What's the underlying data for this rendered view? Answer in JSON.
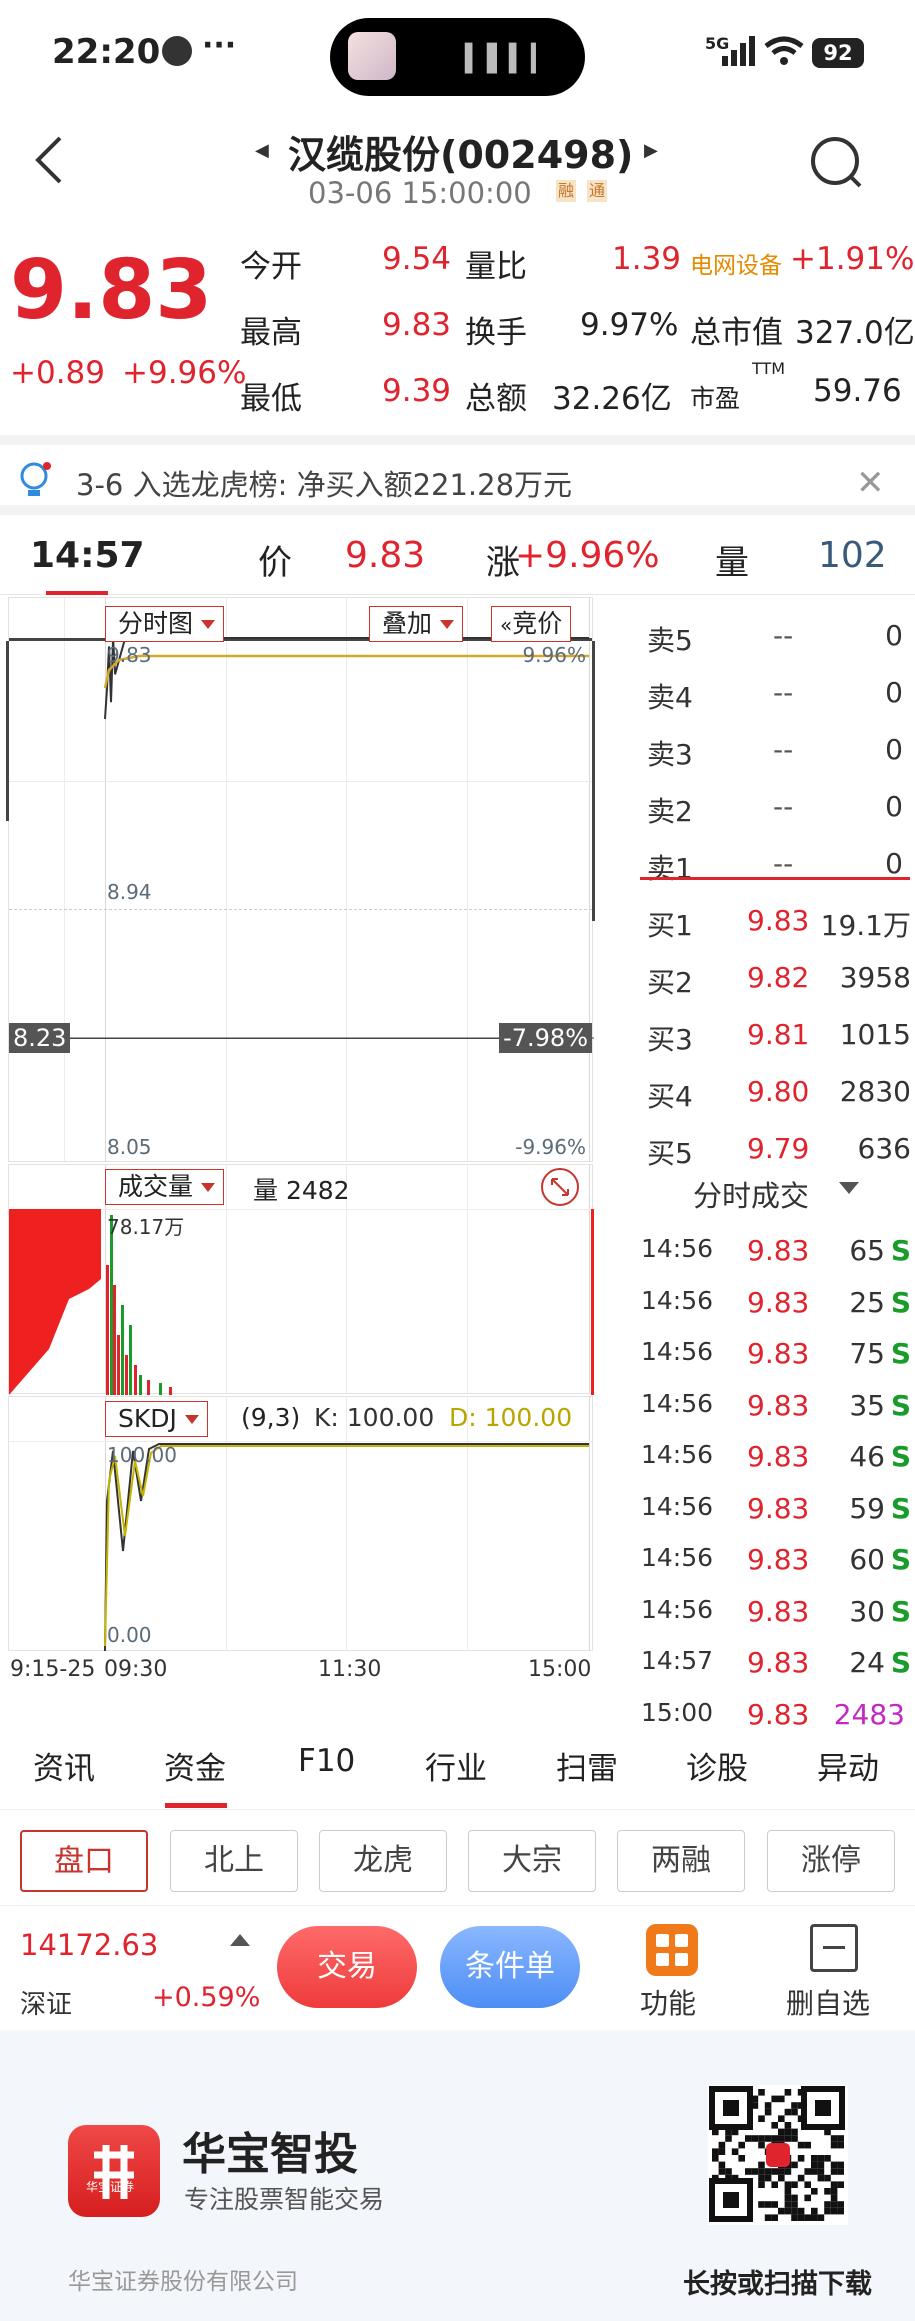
{
  "status_bar": {
    "time": "22:20",
    "more": "···",
    "network": "5G",
    "battery": "92"
  },
  "header": {
    "title": "汉缆股份(002498)",
    "datetime": "03-06 15:00:00",
    "badge_rong": "融",
    "badge_tong": "通"
  },
  "quote": {
    "price": "9.83",
    "change": "+0.89",
    "change_pct": "+9.96%",
    "rows": [
      {
        "l1": "今开",
        "v1": "9.54",
        "l2": "量比",
        "v2": "1.39",
        "l3": "电网设备",
        "v3": "+1.91%"
      },
      {
        "l1": "最高",
        "v1": "9.83",
        "l2": "换手",
        "v2": "9.97%",
        "l3": "总市值",
        "v3": "327.0亿"
      },
      {
        "l1": "最低",
        "v1": "9.39",
        "l2": "总额",
        "v2": "32.26亿",
        "l3": "市盈",
        "l3sup": "TTM",
        "v3": "59.76"
      }
    ]
  },
  "news": {
    "text": "3-6 入选龙虎榜: 净买入额221.28万元"
  },
  "realtime": {
    "time": "14:57",
    "price_label": "价",
    "price": "9.83",
    "chg_label": "涨",
    "chg": "+9.96%",
    "vol_label": "量",
    "vol": "102"
  },
  "chart_top": {
    "dropdown": "分时图",
    "overlay": "叠加",
    "auction": "竞价",
    "hi_price": "9.83",
    "hi_pct": "9.96%",
    "mid_price": "8.94",
    "prev_close": "8.23",
    "prev_pct": "-7.98%",
    "lo_price": "8.05",
    "lo_pct": "-9.96%"
  },
  "chart_vol": {
    "dropdown": "成交量",
    "vol_label": "量 2482",
    "max": "78.17万"
  },
  "chart_skdj": {
    "dropdown": "SKDJ",
    "params": "(9,3)",
    "k": "K: 100.00",
    "d": "D: 100.00",
    "top": "100.00",
    "bottom": "0.00"
  },
  "xaxis": {
    "t0": "9:15-25",
    "t1": "09:30",
    "t2": "11:30",
    "t3": "15:00"
  },
  "chart_data": {
    "type": "line",
    "title": "分时图",
    "x": [
      "09:30",
      "09:31",
      "09:32",
      "09:33",
      "09:34",
      "09:35",
      "09:40",
      "10:00",
      "11:30",
      "13:00",
      "14:57",
      "15:00"
    ],
    "series": [
      {
        "name": "价",
        "values": [
          9.54,
          9.65,
          9.8,
          9.6,
          9.83,
          9.7,
          9.83,
          9.83,
          9.83,
          9.83,
          9.83,
          9.83
        ]
      }
    ],
    "ylim": [
      8.05,
      9.83
    ],
    "prev_close": 8.23
  },
  "book": {
    "sells": [
      {
        "label": "卖5",
        "price": "--",
        "vol": "0"
      },
      {
        "label": "卖4",
        "price": "--",
        "vol": "0"
      },
      {
        "label": "卖3",
        "price": "--",
        "vol": "0"
      },
      {
        "label": "卖2",
        "price": "--",
        "vol": "0"
      },
      {
        "label": "卖1",
        "price": "--",
        "vol": "0"
      }
    ],
    "buys": [
      {
        "label": "买1",
        "price": "9.83",
        "vol": "19.1万"
      },
      {
        "label": "买2",
        "price": "9.82",
        "vol": "3958"
      },
      {
        "label": "买3",
        "price": "9.81",
        "vol": "1015"
      },
      {
        "label": "买4",
        "price": "9.80",
        "vol": "2830"
      },
      {
        "label": "买5",
        "price": "9.79",
        "vol": "636"
      }
    ],
    "ticks_title": "分时成交",
    "ticks": [
      {
        "time": "14:56",
        "price": "9.83",
        "vol": "65",
        "flag": "S"
      },
      {
        "time": "14:56",
        "price": "9.83",
        "vol": "25",
        "flag": "S"
      },
      {
        "time": "14:56",
        "price": "9.83",
        "vol": "75",
        "flag": "S"
      },
      {
        "time": "14:56",
        "price": "9.83",
        "vol": "35",
        "flag": "S"
      },
      {
        "time": "14:56",
        "price": "9.83",
        "vol": "46",
        "flag": "S"
      },
      {
        "time": "14:56",
        "price": "9.83",
        "vol": "59",
        "flag": "S"
      },
      {
        "time": "14:56",
        "price": "9.83",
        "vol": "60",
        "flag": "S"
      },
      {
        "time": "14:56",
        "price": "9.83",
        "vol": "30",
        "flag": "S"
      },
      {
        "time": "14:57",
        "price": "9.83",
        "vol": "24",
        "flag": "S"
      },
      {
        "time": "15:00",
        "price": "9.83",
        "vol": "2483",
        "flag": ""
      }
    ]
  },
  "tabs": [
    "资讯",
    "资金",
    "F10",
    "行业",
    "扫雷",
    "诊股",
    "异动"
  ],
  "subtabs": [
    "盘口",
    "北上",
    "龙虎",
    "大宗",
    "两融",
    "涨停"
  ],
  "bottombar": {
    "index_value": "14172.63",
    "index_name": "深证",
    "index_change": "+0.59%",
    "trade": "交易",
    "cond": "条件单",
    "func": "功能",
    "delete": "删自选"
  },
  "promo": {
    "brand": "华宝智投",
    "slogan": "专注股票智能交易",
    "logo_text": "华宝证券",
    "company": "华宝证券股份有限公司",
    "scan": "长按或扫描下载"
  }
}
